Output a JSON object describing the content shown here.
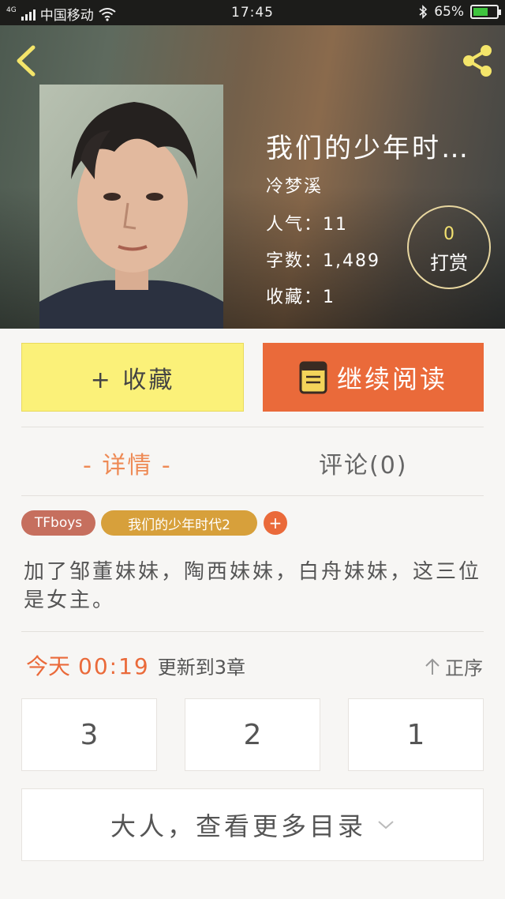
{
  "status_bar": {
    "network": "4G",
    "carrier": "中国移动",
    "time": "17:45",
    "battery": "65%",
    "battery_level": 0.65,
    "icons": [
      "signal-icon",
      "wifi-icon",
      "bluetooth-icon",
      "battery-icon"
    ]
  },
  "header": {
    "title": "我们的少年时…",
    "author": "冷梦溪",
    "popularity": "人气：11",
    "word_count": "字数：1,489",
    "favorites": "收藏：1",
    "tip_count": "0",
    "tip_label": "打赏",
    "icons": [
      "back-icon",
      "share-icon"
    ]
  },
  "actions": {
    "favorite_label": "+ 收藏",
    "read_label": "继续阅读",
    "read_icon": "book-icon"
  },
  "tabs": {
    "detail": "- 详情 -",
    "comments": "评论(0)"
  },
  "tags": [
    "TFboys",
    "我们的少年时代2",
    "+"
  ],
  "description": "加了邹董妹妹，陶西妹妹，白舟妹妹，这三位是女主。",
  "update": {
    "day": "今天",
    "time": "00:19",
    "text": "更新到3章",
    "order": "正序"
  },
  "chapters": [
    "3",
    "2",
    "1"
  ],
  "more_catalog": "大人，查看更多目录",
  "colors": {
    "accent": "#ea6a3a",
    "favorite_bg": "#fbf179",
    "tag_1": "#c66f5e",
    "tag_2": "#d7a03b",
    "back_icon": "#f4e56a"
  }
}
